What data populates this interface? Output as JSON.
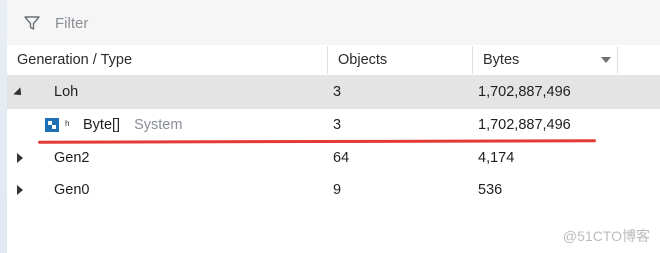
{
  "filter": {
    "placeholder": "Filter"
  },
  "columns": {
    "type": "Generation / Type",
    "objects": "Objects",
    "bytes": "Bytes"
  },
  "rows": [
    {
      "type": "Loh",
      "objects": "3",
      "bytes": "1,702,887,496",
      "expanded": true
    },
    {
      "type": "Byte[]",
      "namespace": "System",
      "objects": "3",
      "bytes": "1,702,887,496",
      "child": true
    },
    {
      "type": "Gen2",
      "objects": "64",
      "bytes": "4,174",
      "expanded": false
    },
    {
      "type": "Gen0",
      "objects": "9",
      "bytes": "536",
      "expanded": false
    }
  ],
  "highlight_color": "#e53935",
  "watermark": "@51CTO博客"
}
